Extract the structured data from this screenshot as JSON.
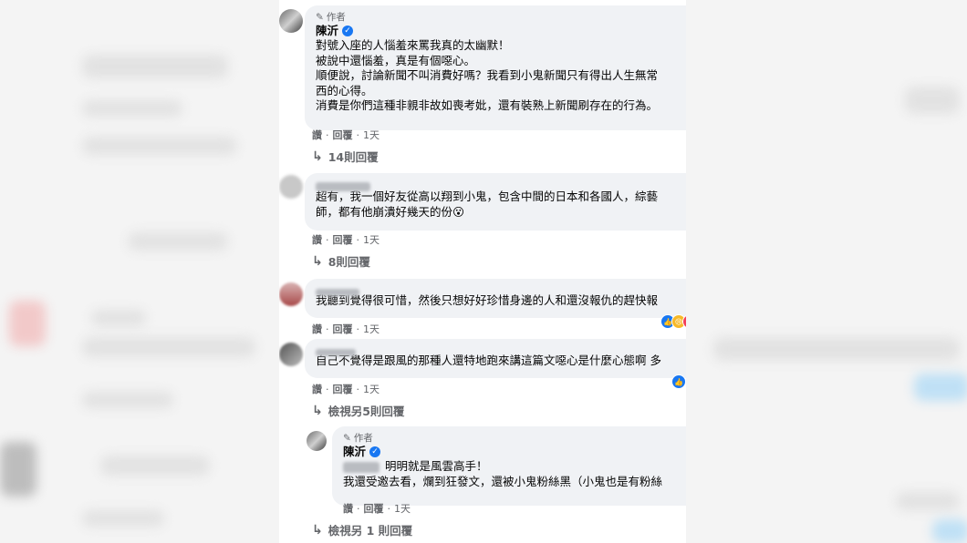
{
  "colors": {
    "accent": "#1877f2",
    "meta": "#65676b",
    "bubble": "#f0f2f5"
  },
  "comment1": {
    "badge": "作者",
    "author": "陳沂",
    "lines": [
      "對號入座的人惱羞來罵我真的太幽默！",
      "被說中還惱羞，真是有個噁心。",
      "順便說，討論新聞不叫消費好嗎？我看到小鬼新聞只有得出人生無常",
      "西的心得。",
      "消費是你們這種非親非故如喪考妣，還有裝熟上新聞刷存在的行為。"
    ],
    "like": "讚",
    "reply": "回覆",
    "time": "1天",
    "replies": "14則回覆"
  },
  "comment2": {
    "lines": [
      "超有，我一個好友從高以翔到小鬼，包含中間的日本和各國人，綜藝",
      "師，都有他崩潰好幾天的份😮"
    ],
    "like": "讚",
    "reply": "回覆",
    "time": "1天",
    "replies": "8則回覆"
  },
  "comment3": {
    "text": "我聽到覺得很可惜，然後只想好好珍惜身邊的人和還沒報仇的趕快報",
    "like": "讚",
    "reply": "回覆",
    "time": "1天"
  },
  "comment4": {
    "text": "自己不覺得是跟風的那種人還特地跑來講這篇文噁心是什麼心態啊 多",
    "like": "讚",
    "reply": "回覆",
    "time": "1天",
    "replies": "檢視另5則回覆"
  },
  "reply1": {
    "badge": "作者",
    "author": "陳沂",
    "lines": [
      "明明就是風雲高手！",
      "我還受邀去看，爛到狂發文，還被小鬼粉絲黑（小鬼也是有粉絲"
    ],
    "like": "讚",
    "reply": "回覆",
    "time": "1天",
    "more": "檢視另 1 則回覆"
  }
}
